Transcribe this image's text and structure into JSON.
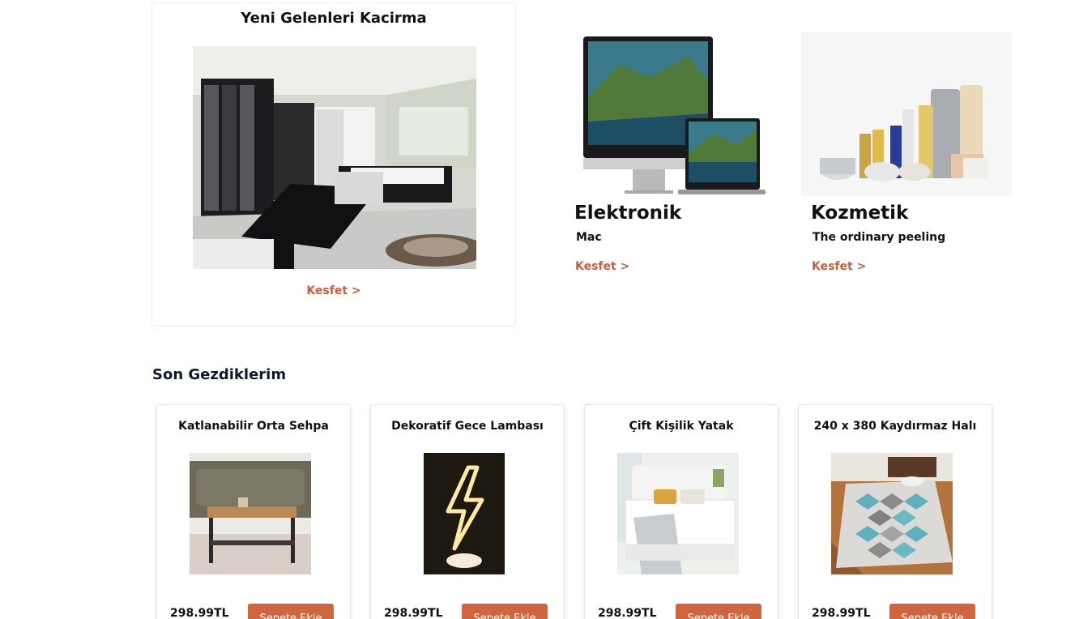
{
  "featured": {
    "title": "Yeni Gelenleri Kacirma",
    "image": "bedroom-furniture-photo",
    "link_label": "Kesfet >"
  },
  "promos": [
    {
      "title": "Elektronik",
      "subtitle": "Mac",
      "image": "imac-macbook-photo",
      "link_label": "Kesfet >"
    },
    {
      "title": "Kozmetik",
      "subtitle": "The ordinary peeling",
      "image": "cosmetics-bottles-photo",
      "link_label": "Kesfet >"
    }
  ],
  "recent": {
    "title": "Son Gezdiklerim",
    "products": [
      {
        "name": "Katlanabilir Orta Sehpa",
        "price": "298.99TL",
        "button": "Sepete Ekle",
        "image": "coffee-table-photo"
      },
      {
        "name": "Dekoratif Gece Lambası",
        "price": "298.99TL",
        "button": "Sepete Ekle",
        "image": "neon-lightning-lamp-photo"
      },
      {
        "name": "Çift Kişilik Yatak",
        "price": "298.99TL",
        "button": "Sepete Ekle",
        "image": "double-bed-photo"
      },
      {
        "name": "240 x 380 Kaydırmaz Halı",
        "price": "298.99TL",
        "button": "Sepete Ekle",
        "image": "rug-photo"
      }
    ]
  },
  "colors": {
    "accent": "#d0663f",
    "link": "#c0623d",
    "text": "#0f1a2b"
  }
}
